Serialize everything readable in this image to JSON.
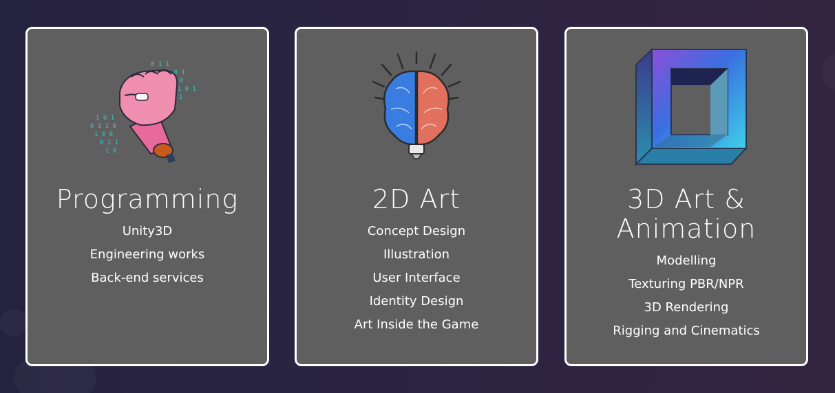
{
  "colors": {
    "background": "#2a2442",
    "card_background": "#5f5f5f",
    "card_border": "#ffffff",
    "text": "#ffffff"
  },
  "cards": [
    {
      "icon": "fist-binary-code-icon",
      "title": "Programming",
      "items": [
        "Unity3D",
        "Engineering works",
        "Back-end services"
      ]
    },
    {
      "icon": "brain-lightbulb-icon",
      "title": "2D Art",
      "items": [
        "Concept Design",
        "Illustration",
        "User Interface",
        "Identity Design",
        "Art Inside the Game"
      ]
    },
    {
      "icon": "impossible-cube-frame-icon",
      "title": "3D Art & Animation",
      "items": [
        "Modelling",
        "Texturing PBR/NPR",
        "3D Rendering",
        "Rigging and Cinematics"
      ]
    }
  ]
}
